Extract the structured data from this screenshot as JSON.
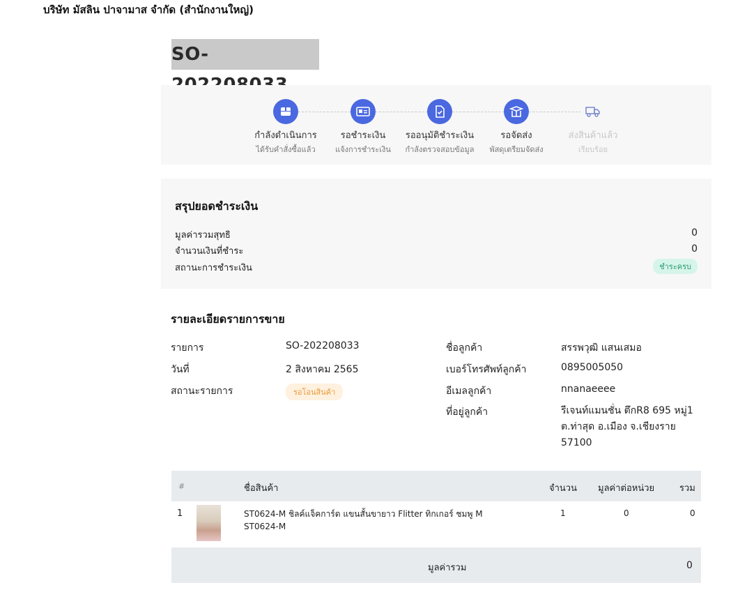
{
  "company": "บริษัท มัสลิน ปาจามาส จำกัด (สำนักงานใหญ่)",
  "order_id": "SO-202208033",
  "steps": [
    {
      "label": "กำลังดำเนินการ",
      "sub": "ได้รับคำสั่งซื้อแล้ว",
      "icon": "box-icon",
      "status": "done"
    },
    {
      "label": "รอชำระเงิน",
      "sub": "แจ้งการชำระเงิน",
      "icon": "payment-card-icon",
      "status": "done"
    },
    {
      "label": "รออนุมัติชำระเงิน",
      "sub": "กำลังตรวจสอบข้อมูล",
      "icon": "document-check-icon",
      "status": "done"
    },
    {
      "label": "รอจัดส่ง",
      "sub": "พัสดุเตรียมจัดส่ง",
      "icon": "package-open-icon",
      "status": "done"
    },
    {
      "label": "ส่งสินค้าแล้ว",
      "sub": "เรียบร้อย",
      "icon": "truck-icon",
      "status": "pending"
    }
  ],
  "summary": {
    "title": "สรุปยอดชำระเงิน",
    "net_total_label": "มูลค่ารวมสุทธิ",
    "net_total_value": "0",
    "paid_label": "จำนวนเงินที่ชำระ",
    "paid_value": "0",
    "status_label": "สถานะการชำระเงิน",
    "status_badge": "ชำระครบ"
  },
  "details": {
    "title": "รายละเอียดรายการขาย",
    "item_label": "รายการ",
    "item_value": "SO-202208033",
    "date_label": "วันที่",
    "date_value": "2 สิงหาคม 2565",
    "status_label": "สถานะรายการ",
    "status_badge": "รอโอนสินค้า",
    "customer_label": "ชื่อลูกค้า",
    "customer_value": "สรรพวุฒิ แสนเสมอ",
    "phone_label": "เบอร์โทรศัพท์ลูกค้า",
    "phone_value": "0895005050",
    "email_label": "อีเมลลูกค้า",
    "email_value": "nnanaeeee",
    "address_label": "ที่อยู่ลูกค้า",
    "address_line1": "รีเจนท์แมนชั่น ตึกR8 695 หมู่1",
    "address_line2": "ต.ท่าสุด อ.เมือง จ.เชียงราย",
    "address_line3": "57100"
  },
  "table": {
    "headers": {
      "num": "#",
      "name": "ชื่อสินค้า",
      "qty": "จำนวน",
      "unit_price": "มูลค่าต่อหน่วย",
      "total": "รวม"
    },
    "rows": [
      {
        "num": "1",
        "name": "ST0624-M ชิลค์แจ็คการ์ด แขนสั้นขายาว Flitter ทิกเกอร์ ชมพู M",
        "sku": "ST0624-M",
        "qty": "1",
        "unit_price": "0",
        "total": "0"
      }
    ],
    "footer_label": "มูลค่ารวม",
    "footer_value": "0"
  },
  "colors": {
    "step_done": "#4a68e0",
    "badge_green_bg": "#d6f5ea",
    "badge_green_text": "#2a9a72",
    "badge_orange_bg": "#fff1df",
    "badge_orange_text": "#e89a3c"
  }
}
